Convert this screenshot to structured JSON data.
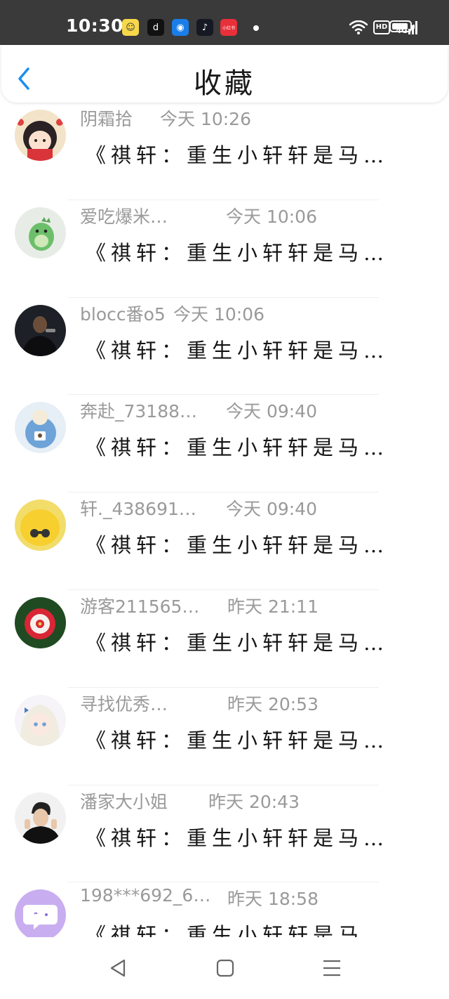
{
  "status": {
    "time": "10:30",
    "app_icons": [
      {
        "name": "emoji-app-icon",
        "bg": "#f7d84a",
        "glyph": "☺"
      },
      {
        "name": "reader-app-icon",
        "bg": "#111111",
        "glyph": "d"
      },
      {
        "name": "browser-app-icon",
        "bg": "#1a7ee8",
        "glyph": "◉"
      },
      {
        "name": "tiktok-app-icon",
        "bg": "#161823",
        "glyph": "♪"
      },
      {
        "name": "xiaohongshu-app-icon",
        "bg": "#e8303a",
        "glyph": "小红书"
      }
    ],
    "hd_label": "HD",
    "network_label": "4G",
    "battery_level": 0.9
  },
  "header": {
    "title": "收藏"
  },
  "items": [
    {
      "user": "阴霜拾",
      "time": "今天 10:26",
      "message": "《祺轩：重生小轩轩是马…",
      "avatar": "avatar-cartoon-girl"
    },
    {
      "user": "爱吃爆米…",
      "time": "今天 10:06",
      "message": "《祺轩：重生小轩轩是马…",
      "avatar": "avatar-green-dinosaur"
    },
    {
      "user": "blocc番o5",
      "time": "今天 10:06",
      "message": "《祺轩：重生小轩轩是马…",
      "avatar": "avatar-man-dark"
    },
    {
      "user": "奔赴_73188…",
      "time": "今天 09:40",
      "message": "《祺轩：重生小轩轩是马…",
      "avatar": "avatar-bear-toy"
    },
    {
      "user": "轩._438691…",
      "time": "今天 09:40",
      "message": "《祺轩：重生小轩轩是马…",
      "avatar": "avatar-yellow-chick"
    },
    {
      "user": "游客211565…",
      "time": "昨天 21:11",
      "message": "《祺轩：重生小轩轩是马…",
      "avatar": "avatar-red-flower"
    },
    {
      "user": "寻找优秀…",
      "time": "昨天 20:53",
      "message": "《祺轩：重生小轩轩是马…",
      "avatar": "avatar-anime-girl"
    },
    {
      "user": "潘家大小姐",
      "time": "昨天 20:43",
      "message": "《祺轩：重生小轩轩是马…",
      "avatar": "avatar-young-man"
    },
    {
      "user": "198***692_6…",
      "time": "昨天 18:58",
      "message": "《祺轩：重生小轩轩是马…",
      "avatar": "avatar-chat-bubble"
    }
  ],
  "colors": {
    "accent": "#1a8ef0",
    "status_bar": "#3a3a3a",
    "meta_text": "#9a9a9a",
    "message_text": "#151515"
  },
  "nav": [
    {
      "name": "nav-back-button",
      "icon": "triangle-back-icon"
    },
    {
      "name": "nav-home-button",
      "icon": "square-home-icon"
    },
    {
      "name": "nav-menu-button",
      "icon": "menu-lines-icon"
    }
  ]
}
